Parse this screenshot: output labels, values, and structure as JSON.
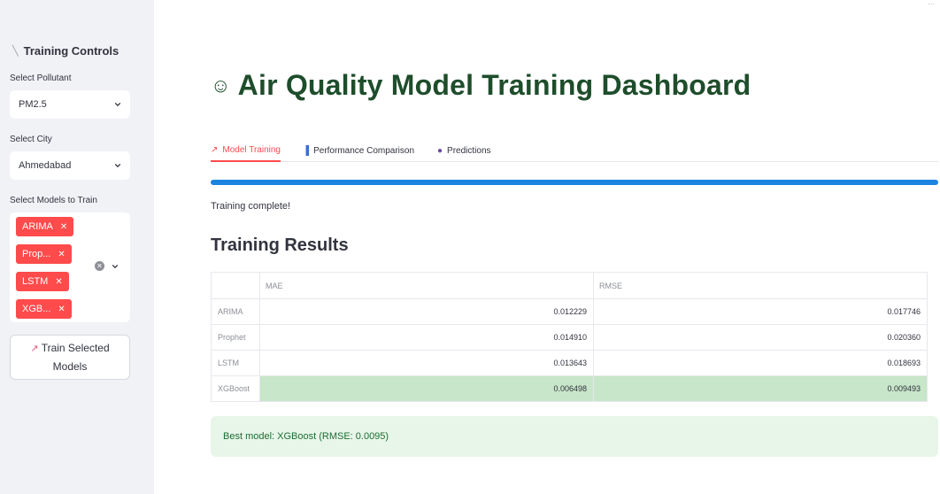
{
  "sidebar": {
    "title": "Training Controls",
    "pollutant_label": "Select Pollutant",
    "pollutant_value": "PM2.5",
    "city_label": "Select City",
    "city_value": "Ahmedabad",
    "models_label": "Select Models to Train",
    "selected_models": [
      "ARIMA",
      "Prop...",
      "LSTM",
      "XGB..."
    ],
    "train_button": {
      "line1": "Train Selected",
      "line2": "Models"
    }
  },
  "main": {
    "title": "Air Quality Model Training Dashboard",
    "tabs": [
      {
        "label": "Model Training",
        "icon": "chart-increasing-icon",
        "active": true
      },
      {
        "label": "Performance Comparison",
        "icon": "bar-chart-icon",
        "active": false
      },
      {
        "label": "Predictions",
        "icon": "crystal-ball-icon",
        "active": false
      }
    ],
    "progress_fraction": 1.0,
    "status_text": "Training complete!",
    "results_heading": "Training Results",
    "table": {
      "columns": [
        "",
        "MAE",
        "RMSE"
      ],
      "rows": [
        {
          "model": "ARIMA",
          "mae": "0.012229",
          "rmse": "0.017746"
        },
        {
          "model": "Prophet",
          "mae": "0.014910",
          "rmse": "0.020360"
        },
        {
          "model": "LSTM",
          "mae": "0.013643",
          "rmse": "0.018693"
        },
        {
          "model": "XGBoost",
          "mae": "0.006498",
          "rmse": "0.009493"
        }
      ]
    },
    "best_model_text": "Best model: XGBoost (RMSE: 0.0095)"
  },
  "colors": {
    "accent": "#ff4b4b",
    "progress": "#1c83e1",
    "title": "#1e4d2b",
    "success_bg": "#e8f5e9",
    "highlight": "#c8e6c9"
  }
}
